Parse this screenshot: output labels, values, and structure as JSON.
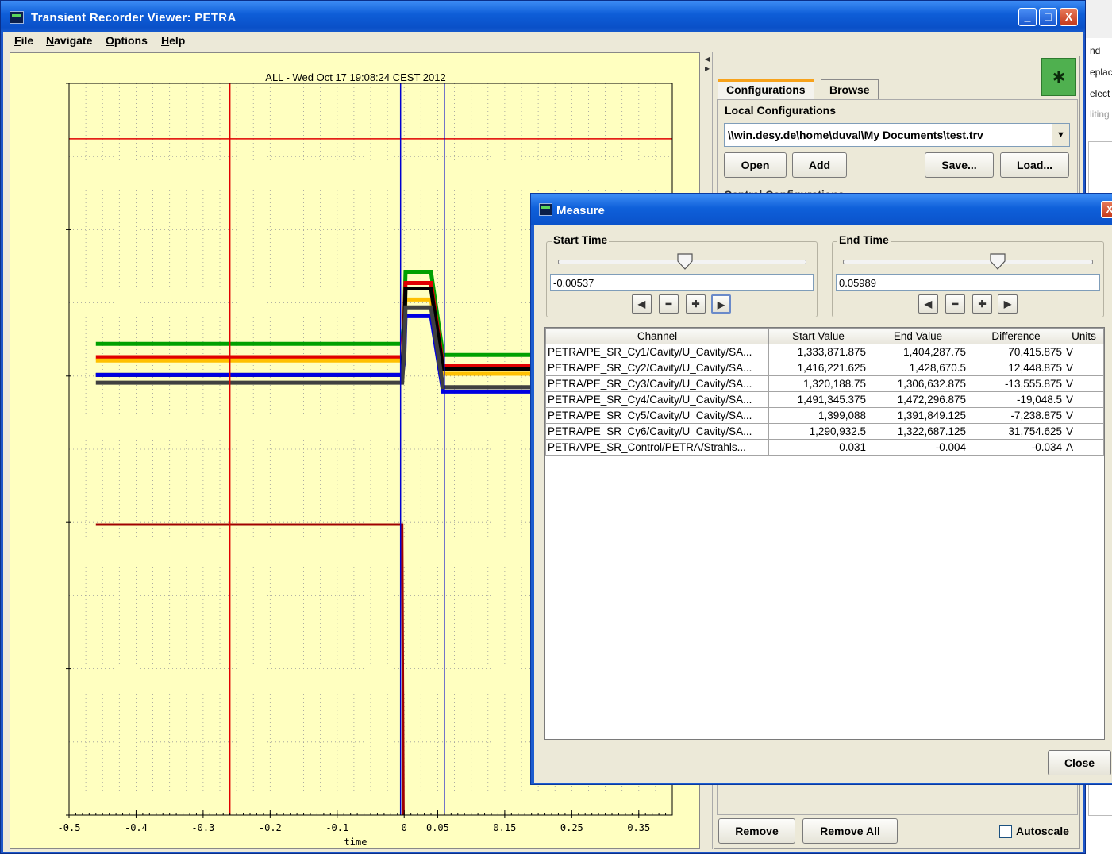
{
  "window": {
    "title": "Transient Recorder Viewer:   PETRA",
    "min": "_",
    "max": "□",
    "close": "X"
  },
  "menu": [
    "File",
    "Navigate",
    "Options",
    "Help"
  ],
  "plot": {
    "title": "ALL - Wed Oct 17 19:08:24 CEST 2012",
    "xlabel": "time",
    "xticks": [
      "-0.5",
      "-0.4",
      "-0.3",
      "-0.2",
      "-0.1",
      "0",
      "0.05",
      "0.15",
      "0.25",
      "0.35"
    ]
  },
  "chart_data": {
    "type": "line",
    "title": "ALL - Wed Oct 17 19:08:24 CEST 2012",
    "xlabel": "time",
    "ylabel": "",
    "xlim": [
      -0.5,
      0.4
    ],
    "x_tick_values": [
      -0.5,
      -0.4,
      -0.3,
      -0.2,
      -0.1,
      0,
      0.05,
      0.15,
      0.25,
      0.35
    ],
    "grid": true,
    "cursors": {
      "red_vertical": -0.26,
      "blue_start": -0.00537,
      "blue_end": 0.05989
    },
    "series": [
      {
        "color": "#00a000",
        "x": [
          -0.46,
          -0.003,
          0.0,
          0.002,
          0.04,
          0.058,
          0.2
        ],
        "y": [
          4.25,
          4.25,
          4.45,
          4.9,
          4.9,
          4.15,
          4.15
        ]
      },
      {
        "color": "#e00000",
        "x": [
          -0.46,
          -0.003,
          0.0,
          0.002,
          0.04,
          0.058,
          0.2
        ],
        "y": [
          4.13,
          4.13,
          4.45,
          4.8,
          4.8,
          4.05,
          4.05
        ]
      },
      {
        "color": "#ffc000",
        "x": [
          -0.46,
          -0.003,
          0.0,
          0.002,
          0.04,
          0.058,
          0.2
        ],
        "y": [
          4.1,
          4.1,
          4.35,
          4.65,
          4.65,
          3.98,
          3.98
        ]
      },
      {
        "color": "#000000",
        "x": [
          -0.46,
          -0.003,
          0.0,
          0.002,
          0.04,
          0.058,
          0.2
        ],
        "y": [
          3.97,
          3.97,
          4.3,
          4.75,
          4.75,
          4.02,
          4.02
        ]
      },
      {
        "color": "#0000e0",
        "x": [
          -0.46,
          -0.003,
          0.0,
          0.002,
          0.04,
          0.058,
          0.2
        ],
        "y": [
          3.97,
          3.97,
          4.1,
          4.5,
          4.5,
          3.82,
          3.82
        ]
      },
      {
        "color": "#404040",
        "x": [
          -0.46,
          -0.003,
          0.0,
          0.002,
          0.04,
          0.058,
          0.2
        ],
        "y": [
          3.9,
          3.9,
          4.2,
          4.58,
          4.58,
          3.86,
          3.86
        ]
      },
      {
        "color": "#a00000",
        "x": [
          -0.46,
          -0.003,
          -0.001
        ],
        "y": [
          2.62,
          2.62,
          0.0
        ]
      }
    ]
  },
  "right": {
    "tabs": [
      "Configurations",
      "Browse"
    ],
    "group_local": "Local Configurations",
    "combo_value": "\\\\win.desy.de\\home\\duval\\My Documents\\test.trv",
    "buttons": {
      "open": "Open",
      "add": "Add",
      "save": "Save...",
      "load": "Load..."
    },
    "partial_label": "Central Configurations",
    "remove": "Remove",
    "remove_all": "Remove All",
    "autoscale": "Autoscale"
  },
  "bg_window_texts": [
    "nd",
    "eplac",
    "elect",
    "liting"
  ],
  "measure": {
    "title": "Measure",
    "start": {
      "label": "Start Time",
      "value": "-0.00537",
      "slider_fraction": 0.51
    },
    "end": {
      "label": "End Time",
      "value": "0.05989",
      "slider_fraction": 0.62
    },
    "headers": [
      "Channel",
      "Start Value",
      "End Value",
      "Difference",
      "Units"
    ],
    "rows": [
      [
        "PETRA/PE_SR_Cy1/Cavity/U_Cavity/SA...",
        "1,333,871.875",
        "1,404,287.75",
        "70,415.875",
        "V"
      ],
      [
        "PETRA/PE_SR_Cy2/Cavity/U_Cavity/SA...",
        "1,416,221.625",
        "1,428,670.5",
        "12,448.875",
        "V"
      ],
      [
        "PETRA/PE_SR_Cy3/Cavity/U_Cavity/SA...",
        "1,320,188.75",
        "1,306,632.875",
        "-13,555.875",
        "V"
      ],
      [
        "PETRA/PE_SR_Cy4/Cavity/U_Cavity/SA...",
        "1,491,345.375",
        "1,472,296.875",
        "-19,048.5",
        "V"
      ],
      [
        "PETRA/PE_SR_Cy5/Cavity/U_Cavity/SA...",
        "1,399,088",
        "1,391,849.125",
        "-7,238.875",
        "V"
      ],
      [
        "PETRA/PE_SR_Cy6/Cavity/U_Cavity/SA...",
        "1,290,932.5",
        "1,322,687.125",
        "31,754.625",
        "V"
      ],
      [
        "PETRA/PE_SR_Control/PETRA/Strahls...",
        "0.031",
        "-0.004",
        "-0.034",
        "A"
      ]
    ],
    "close": "Close"
  }
}
